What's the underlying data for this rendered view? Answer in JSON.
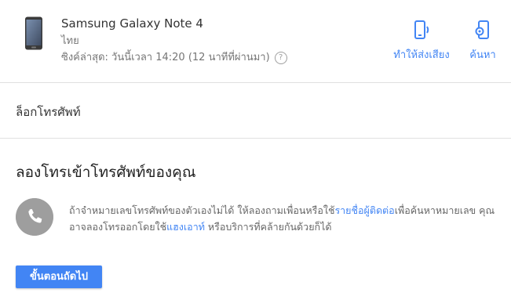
{
  "device": {
    "name": "Samsung Galaxy Note 4",
    "region": "ไทย",
    "last_sync": "ซิงค์ล่าสุด: วันนี้เวลา 14:20 (12 นาทีที่ผ่านมา)",
    "help_glyph": "?"
  },
  "actions": {
    "ring_label": "ทำให้ส่งเสียง",
    "find_label": "ค้นหา"
  },
  "lock": {
    "title": "ล็อกโทรศัพท์"
  },
  "call": {
    "title": "ลองโทรเข้าโทรศัพท์ของคุณ",
    "text_before_link1": "ถ้าจำหมายเลขโทรศัพท์ของตัวเองไม่ได้ ให้ลองถามเพื่อนหรือใช้",
    "link1": "รายชื่อผู้ติดต่อ",
    "text_between": "เพื่อค้นหาหมายเลข คุณอาจลองโทรออกโดยใช้",
    "link2": "แฮงเอาท์",
    "text_after_link2": " หรือบริการที่คล้ายกันด้วยก็ได้"
  },
  "next_button": "ขั้นตอนถัดไป",
  "colors": {
    "accent": "#4285f4",
    "divider": "#e0e0e0",
    "call_circle": "#9e9e9e"
  }
}
